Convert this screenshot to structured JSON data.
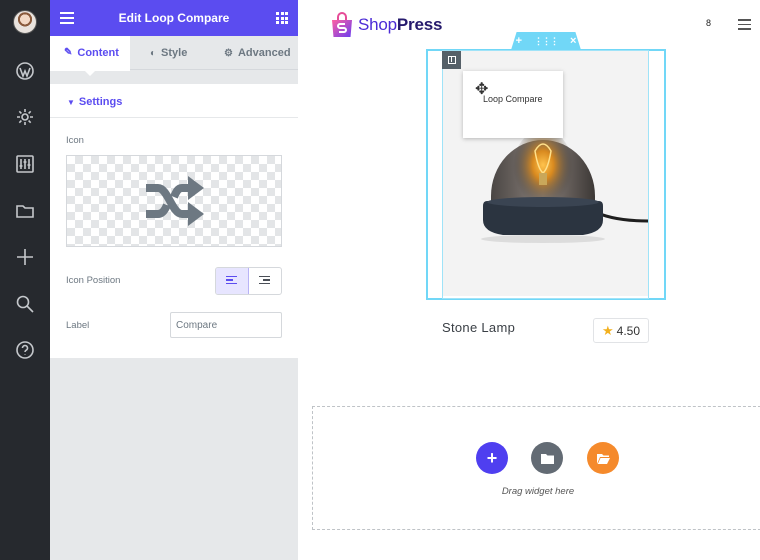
{
  "panel": {
    "title": "Edit Loop Compare",
    "tabs": [
      {
        "label": "Content",
        "icon": "pencil-icon",
        "active": true
      },
      {
        "label": "Style",
        "icon": "contrast-icon",
        "active": false
      },
      {
        "label": "Advanced",
        "icon": "gear-icon",
        "active": false
      }
    ],
    "section": {
      "label": "Settings"
    },
    "fields": {
      "icon_label": "Icon",
      "icon_preview": "shuffle-icon",
      "position_label": "Icon Position",
      "position_selected": "left",
      "label_label": "Label",
      "label_value": "Compare"
    }
  },
  "rail": [
    "avatar",
    "wordpress-icon",
    "gear-icon",
    "sliders-icon",
    "folder-icon",
    "plus-icon",
    "search-icon",
    "help-icon"
  ],
  "canvas": {
    "logo": {
      "part1": "Shop",
      "part2": "Press"
    },
    "top_count": "8",
    "widget_tooltip": "Loop Compare",
    "product": {
      "name": "Stone Lamp",
      "rating": "4.50"
    },
    "dropzone_text": "Drag widget here"
  },
  "colors": {
    "accent": "#5b4cf0",
    "selection": "#71d7f7",
    "rail": "#26292e",
    "star": "#f2b01e",
    "orange": "#f58a2c"
  }
}
